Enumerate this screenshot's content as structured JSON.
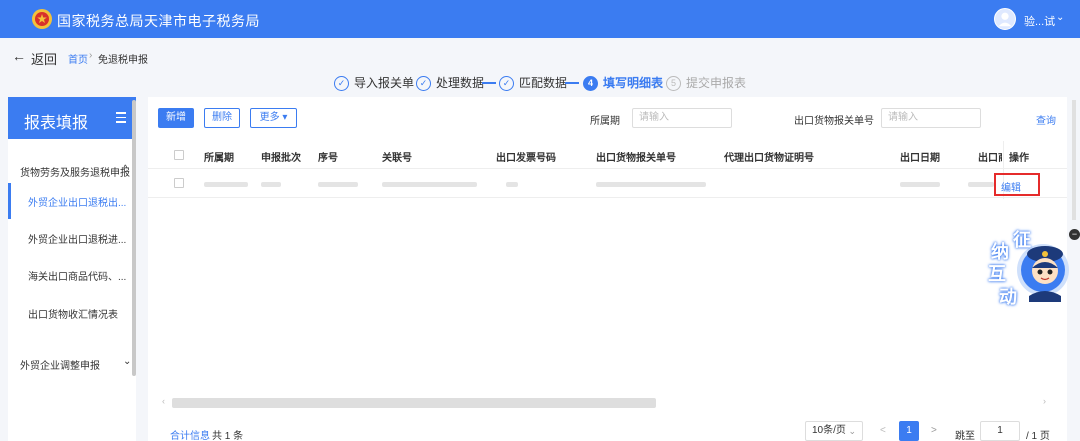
{
  "header": {
    "title": "国家税务总局天津市电子税务局",
    "user_name": "验...试",
    "caret": "⌄"
  },
  "nav": {
    "back_label": "返回",
    "back_arrow": "←",
    "breadcrumb": [
      "首页",
      "免退税申报"
    ],
    "breadcrumb_sep": "›"
  },
  "steps": [
    {
      "num": "✓",
      "label": "导入报关单"
    },
    {
      "num": "✓",
      "label": "处理数据"
    },
    {
      "num": "✓",
      "label": "匹配数据"
    },
    {
      "num": "4",
      "label": "填写明细表"
    },
    {
      "num": "5",
      "label": "提交申报表"
    }
  ],
  "sidebar": {
    "title": "报表填报",
    "groups": [
      {
        "label": "货物劳务及服务退税申报",
        "chevron": "^"
      },
      {
        "label": "外贸企业调整申报",
        "chevron": "⌄"
      }
    ],
    "items": [
      {
        "label": "外贸企业出口退税出..."
      },
      {
        "label": "外贸企业出口退税进..."
      },
      {
        "label": "海关出口商品代码、..."
      },
      {
        "label": "出口货物收汇情况表"
      }
    ]
  },
  "toolbar": {
    "add_label": "新增",
    "delete_label": "删除",
    "more_label": "更多 ▾",
    "period_label": "所属期",
    "period_placeholder": "请输入",
    "customs_label": "出口货物报关单号",
    "customs_placeholder": "请输入",
    "query_label": "查询"
  },
  "table": {
    "columns": [
      "所属期",
      "申报批次",
      "序号",
      "关联号",
      "出口发票号码",
      "出口货物报关单号",
      "代理出口货物证明号",
      "出口日期",
      "出口商",
      "操作"
    ],
    "row_action": "编辑"
  },
  "footer": {
    "total_label": "合计信息",
    "total_count": "共 1 条",
    "page_size": "10条/页",
    "page_size_chev": "⌄",
    "prev": "<",
    "current_page": "1",
    "next": ">",
    "jump_label": "跳至",
    "jump_value": "1",
    "page_total": "/ 1 页",
    "scroll_left": "‹",
    "scroll_right": "›"
  },
  "mascot": {
    "text": [
      "征",
      "纳",
      "互",
      "动"
    ]
  },
  "colors": {
    "primary": "#3b7cf1",
    "highlight": "#e52b2b"
  }
}
